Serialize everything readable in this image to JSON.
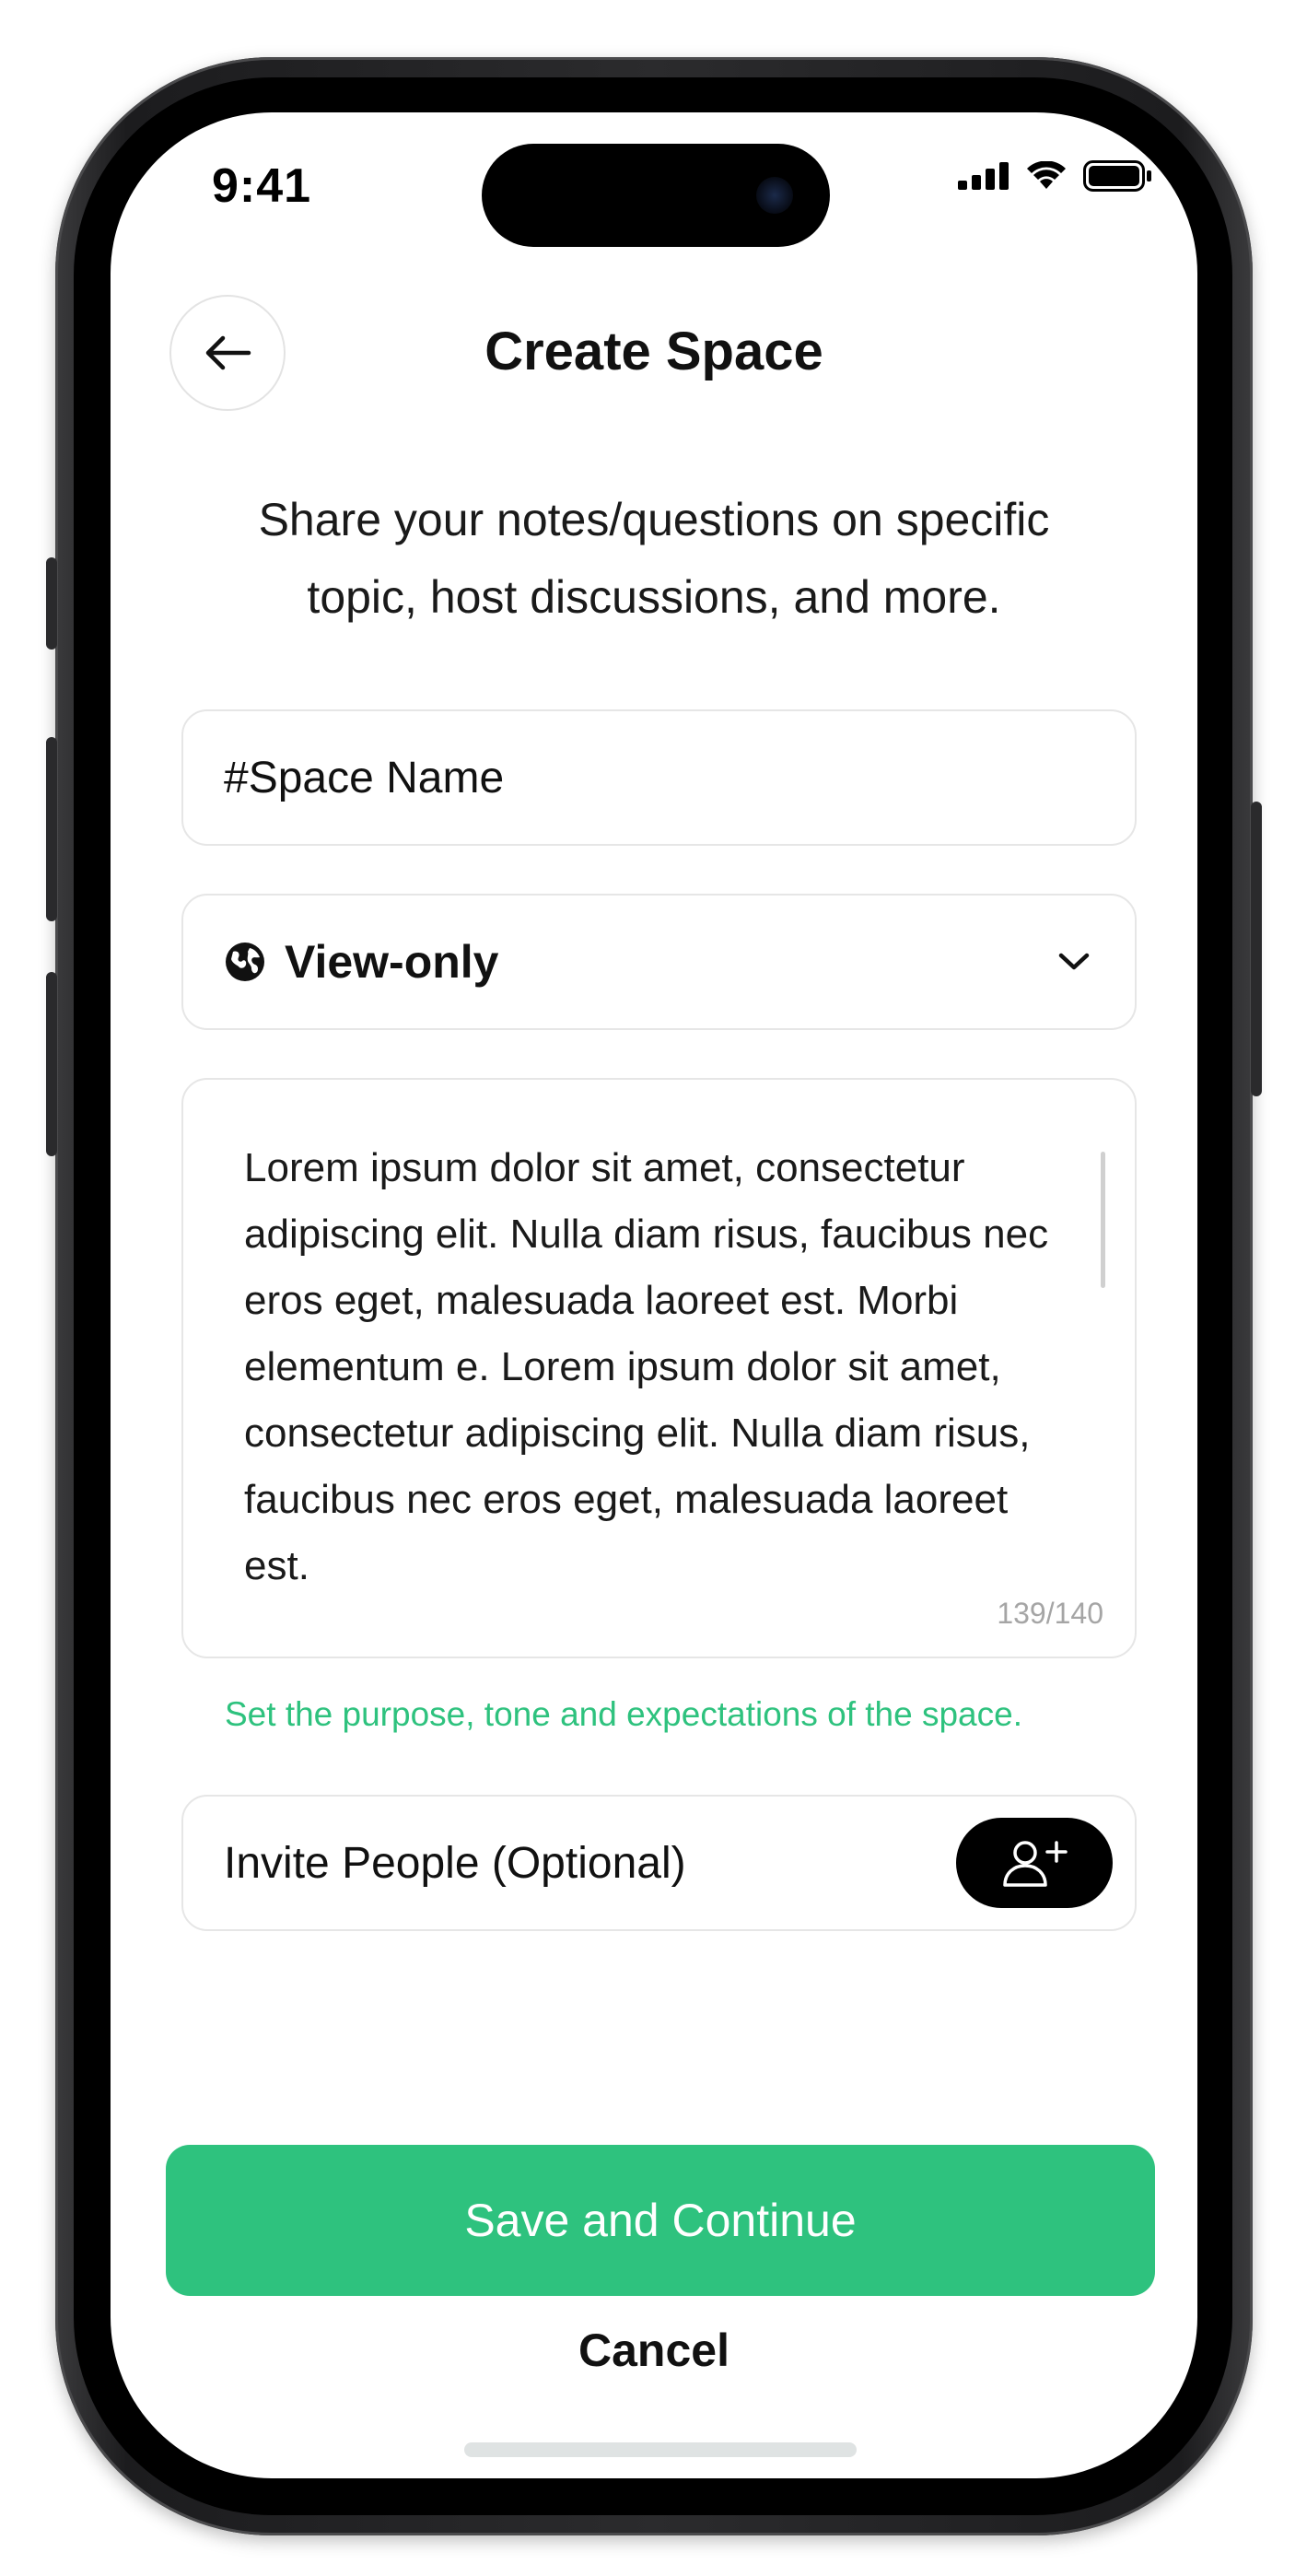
{
  "status_bar": {
    "time": "9:41"
  },
  "header": {
    "title": "Create Space",
    "back_icon": "arrow-left-icon"
  },
  "subtitle": "Share your notes/questions on specific topic, host discussions, and more.",
  "form": {
    "space_name": {
      "placeholder": "#Space Name",
      "value": ""
    },
    "privacy": {
      "icon": "globe-icon",
      "selected": "View-only",
      "dropdown_icon": "chevron-down-icon"
    },
    "description": {
      "value": "Lorem ipsum dolor sit amet, consectetur adipiscing elit. Nulla diam risus, faucibus nec eros eget, malesuada laoreet est. Morbi elementum e. Lorem ipsum dolor sit amet, consectetur adipiscing elit. Nulla diam risus, faucibus nec eros eget, malesuada laoreet est.",
      "char_count": "139/140"
    },
    "helper_text": "Set the purpose, tone and expectations of the space.",
    "invite": {
      "label": "Invite People (Optional)",
      "button_icon": "add-user-icon"
    }
  },
  "actions": {
    "save_label": "Save and Continue",
    "cancel_label": "Cancel"
  },
  "colors": {
    "accent": "#2EC27E",
    "text": "#111111",
    "border": "#E6E6E6"
  }
}
